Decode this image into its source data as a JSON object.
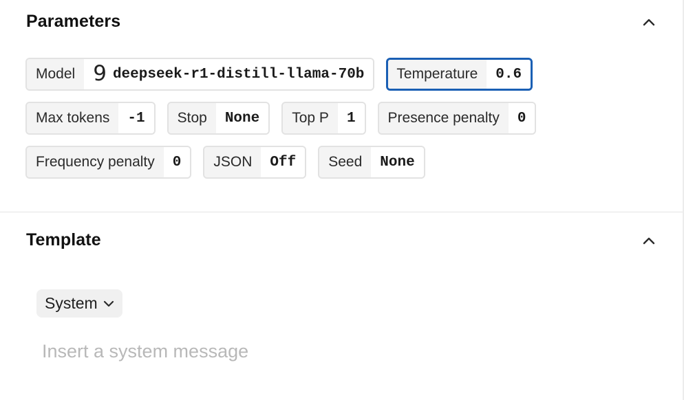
{
  "parameters": {
    "title": "Parameters",
    "collapse_icon": "chevron-up-icon",
    "chips": [
      {
        "label": "Model",
        "value": "deepseek-r1-distill-llama-70b",
        "icon": "model-provider-icon"
      },
      {
        "label": "Temperature",
        "value": "0.6",
        "active": true
      },
      {
        "label": "Max tokens",
        "value": "-1"
      },
      {
        "label": "Stop",
        "value": "None"
      },
      {
        "label": "Top P",
        "value": "1"
      },
      {
        "label": "Presence penalty",
        "value": "0"
      },
      {
        "label": "Frequency penalty",
        "value": "0"
      },
      {
        "label": "JSON",
        "value": "Off"
      },
      {
        "label": "Seed",
        "value": "None"
      }
    ]
  },
  "template": {
    "title": "Template",
    "collapse_icon": "chevron-up-icon",
    "role": "System",
    "role_icon": "chevron-down-icon",
    "message_value": "",
    "message_placeholder": "Insert a system message"
  },
  "colors": {
    "active_border": "#1a5fb4",
    "chip_label_bg": "#f4f4f4",
    "chip_border": "#e2e2e2",
    "placeholder": "#b8b8b8"
  }
}
